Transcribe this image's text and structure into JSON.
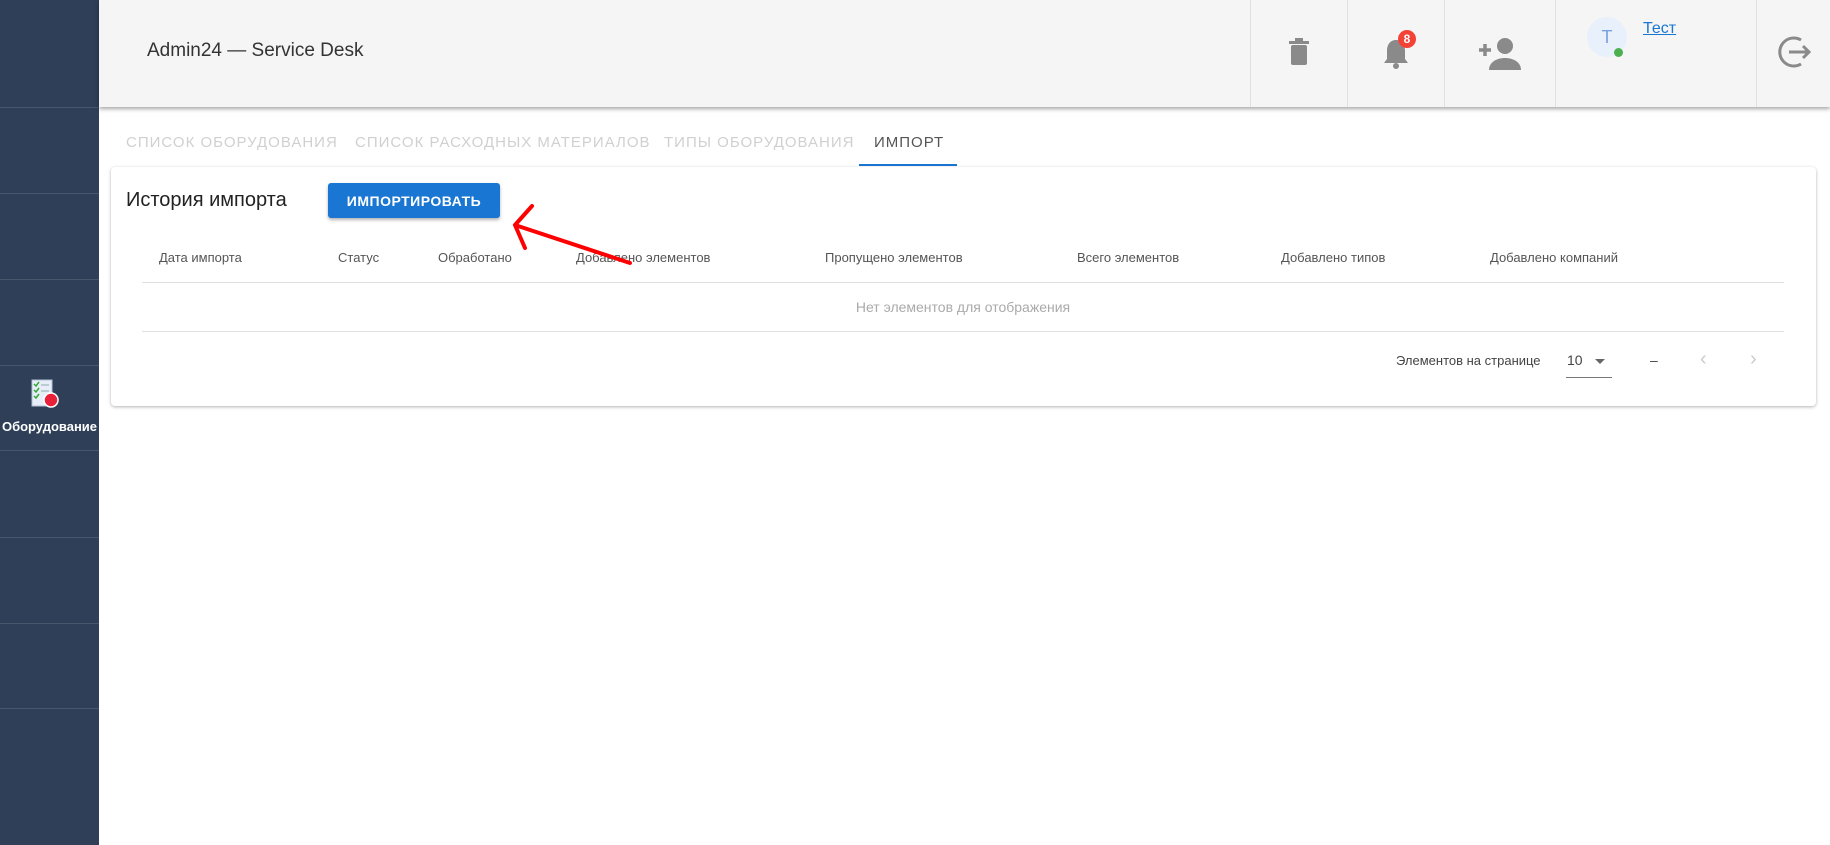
{
  "header": {
    "title": "Admin24 — Service Desk",
    "notification_count": "8",
    "user_initial": "T",
    "user_name": "Тест"
  },
  "sidebar": {
    "items": [
      {
        "label": "Оборудование",
        "icon": "equipment-icon"
      }
    ]
  },
  "tabs": [
    {
      "label": "Список оборудования"
    },
    {
      "label": "Список расходных материалов"
    },
    {
      "label": "Типы оборудования"
    },
    {
      "label": "Импорт",
      "active": true
    }
  ],
  "card": {
    "title": "История импорта",
    "import_button": "ИМПОРТИРОВАТЬ",
    "columns": [
      "Дата импорта",
      "Статус",
      "Обработано",
      "Добавлено элементов",
      "Пропущено элементов",
      "Всего элементов",
      "Добавлено типов",
      "Добавлено компаний"
    ],
    "empty_text": "Нет элементов для отображения",
    "pagination": {
      "label": "Элементов на странице",
      "page_size": "10",
      "range": "–"
    }
  },
  "colors": {
    "sidebar": "#2f3f58",
    "accent": "#1976d2",
    "badge": "#f44336",
    "annotation_arrow": "#ff0000"
  }
}
